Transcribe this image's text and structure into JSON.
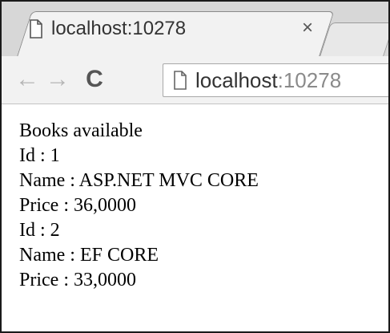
{
  "tab": {
    "title": "localhost:10278",
    "close_glyph": "×",
    "icon": "page-icon"
  },
  "toolbar": {
    "back_glyph": "←",
    "forward_glyph": "→",
    "reload_glyph": "C",
    "url_host": "localhost",
    "url_port": ":10278",
    "url_icon": "page-icon"
  },
  "page": {
    "heading": "Books available",
    "books": [
      {
        "id": "Id : 1",
        "name": "Name : ASP.NET MVC CORE",
        "price": "Price : 36,0000"
      },
      {
        "id": "Id : 2",
        "name": "Name : EF CORE",
        "price": "Price : 33,0000"
      }
    ]
  },
  "colors": {
    "tabstrip": "#d7d7d7",
    "toolbar": "#f2f2f2",
    "text": "#000000"
  }
}
